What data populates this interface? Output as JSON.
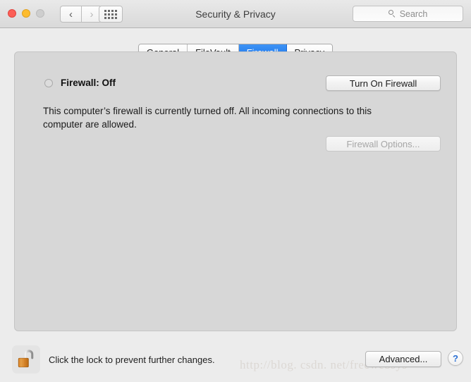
{
  "window": {
    "title": "Security & Privacy",
    "traffic_lights": [
      {
        "name": "close",
        "color": "#fc5f57"
      },
      {
        "name": "minimize",
        "color": "#fdbc2e"
      },
      {
        "name": "zoom",
        "color": "#cecece"
      }
    ],
    "nav": {
      "back_glyph": "‹",
      "forward_glyph": "›"
    },
    "show_all_label": "Show All"
  },
  "search": {
    "placeholder": "Search",
    "value": ""
  },
  "tabs": [
    {
      "label": "General",
      "selected": false
    },
    {
      "label": "FileVault",
      "selected": false
    },
    {
      "label": "Firewall",
      "selected": true
    },
    {
      "label": "Privacy",
      "selected": false
    }
  ],
  "firewall": {
    "status_label": "Firewall: Off",
    "status_state": "off",
    "description": "This computer’s firewall is currently turned off. All incoming connections to this computer are allowed.",
    "turn_on_button": "Turn On Firewall",
    "options_button": "Firewall Options...",
    "options_button_enabled": false
  },
  "footer": {
    "lock_state": "unlocked",
    "lock_caption": "Click the lock to prevent further changes.",
    "advanced_button": "Advanced...",
    "help_button": "?"
  },
  "watermark": "http://blog. csdn. net/freewebsys",
  "colors": {
    "accent": "#1a73e8",
    "window_bg": "#ececec",
    "panel_bg": "#d7d7d7",
    "lock_body": "#e08a2e",
    "help_glyph": "#2b6fd4"
  }
}
